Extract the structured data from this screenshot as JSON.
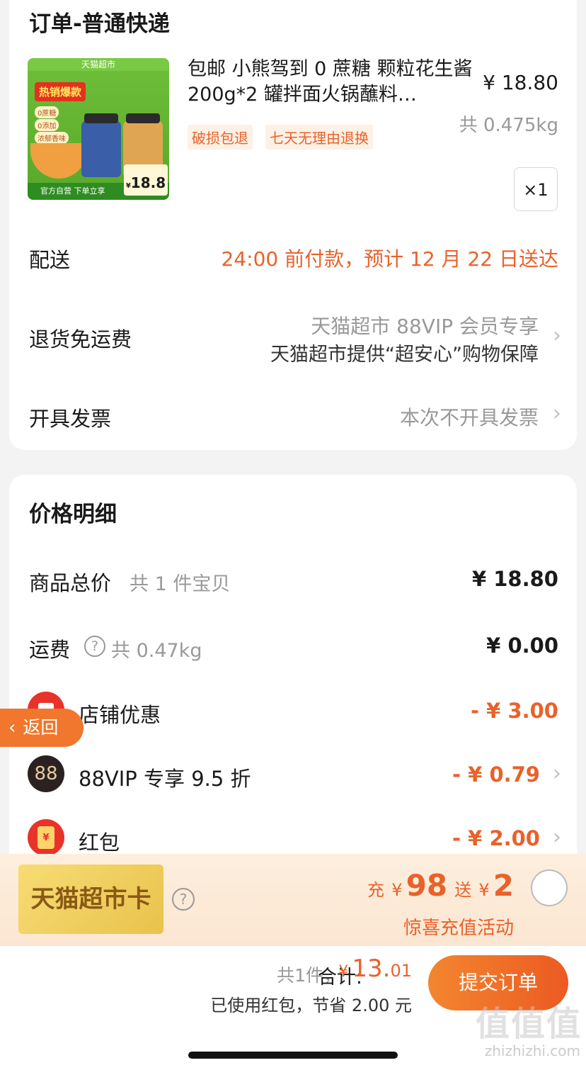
{
  "order": {
    "title": "订单-普通快递",
    "product": {
      "image_label": "天猫超市",
      "image_hot": "热销爆款",
      "image_points": [
        "0蔗糖",
        "0添加",
        "浓郁香味"
      ],
      "image_bottom": "官方自营 下单立享",
      "image_price": "18.8",
      "name": "包邮 小熊驾到 0 蔗糖 颗粒花生酱 200g*2 罐拌面火锅蘸料…",
      "price": "¥ 18.80",
      "weight": "共 0.475kg",
      "tags": [
        "破损包退",
        "七天无理由退换"
      ],
      "quantity": "×1"
    },
    "delivery": {
      "label": "配送",
      "value": "24:00 前付款，预计 12 月 22 日送达"
    },
    "return": {
      "label": "退货免运费",
      "line1": "天猫超市 88VIP 会员专享",
      "line2": "天猫超市提供“超安心”购物保障"
    },
    "invoice": {
      "label": "开具发票",
      "value": "本次不开具发票"
    }
  },
  "price_detail": {
    "title": "价格明细",
    "total": {
      "label": "商品总价",
      "sub": "共 1 件宝贝",
      "value": "¥ 18.80"
    },
    "shipping": {
      "label": "运费",
      "sub": "共 0.47kg",
      "value": "¥ 0.00"
    },
    "store_discount": {
      "label": "店铺优惠",
      "value": "- ¥ 3.00"
    },
    "vip_discount": {
      "icon_text": "88",
      "label": "88VIP 专享 9.5 折",
      "value": "- ¥ 0.79"
    },
    "red_packet": {
      "icon_text": "¥",
      "label": "红包",
      "value": "- ¥ 2.00"
    }
  },
  "back_button": {
    "label": "返回"
  },
  "recharge": {
    "card_label": "天猫超市卡",
    "charge_word": "充",
    "charge_amount": "98",
    "gift_word": "送",
    "gift_amount": "2",
    "currency": "¥",
    "subtitle": "惊喜充值活动"
  },
  "footer": {
    "count": "共1件，",
    "total_label": "合计:",
    "currency": "¥",
    "total_int": "13.",
    "total_dec": "01",
    "saving": "已使用红包，节省 2.00 元",
    "submit": "提交订单"
  },
  "watermark": {
    "text": "值值值",
    "url": "zhizhizhi.com"
  },
  "colors": {
    "accent": "#e8622a",
    "button": "#ec5a22",
    "red": "#e8332a"
  }
}
